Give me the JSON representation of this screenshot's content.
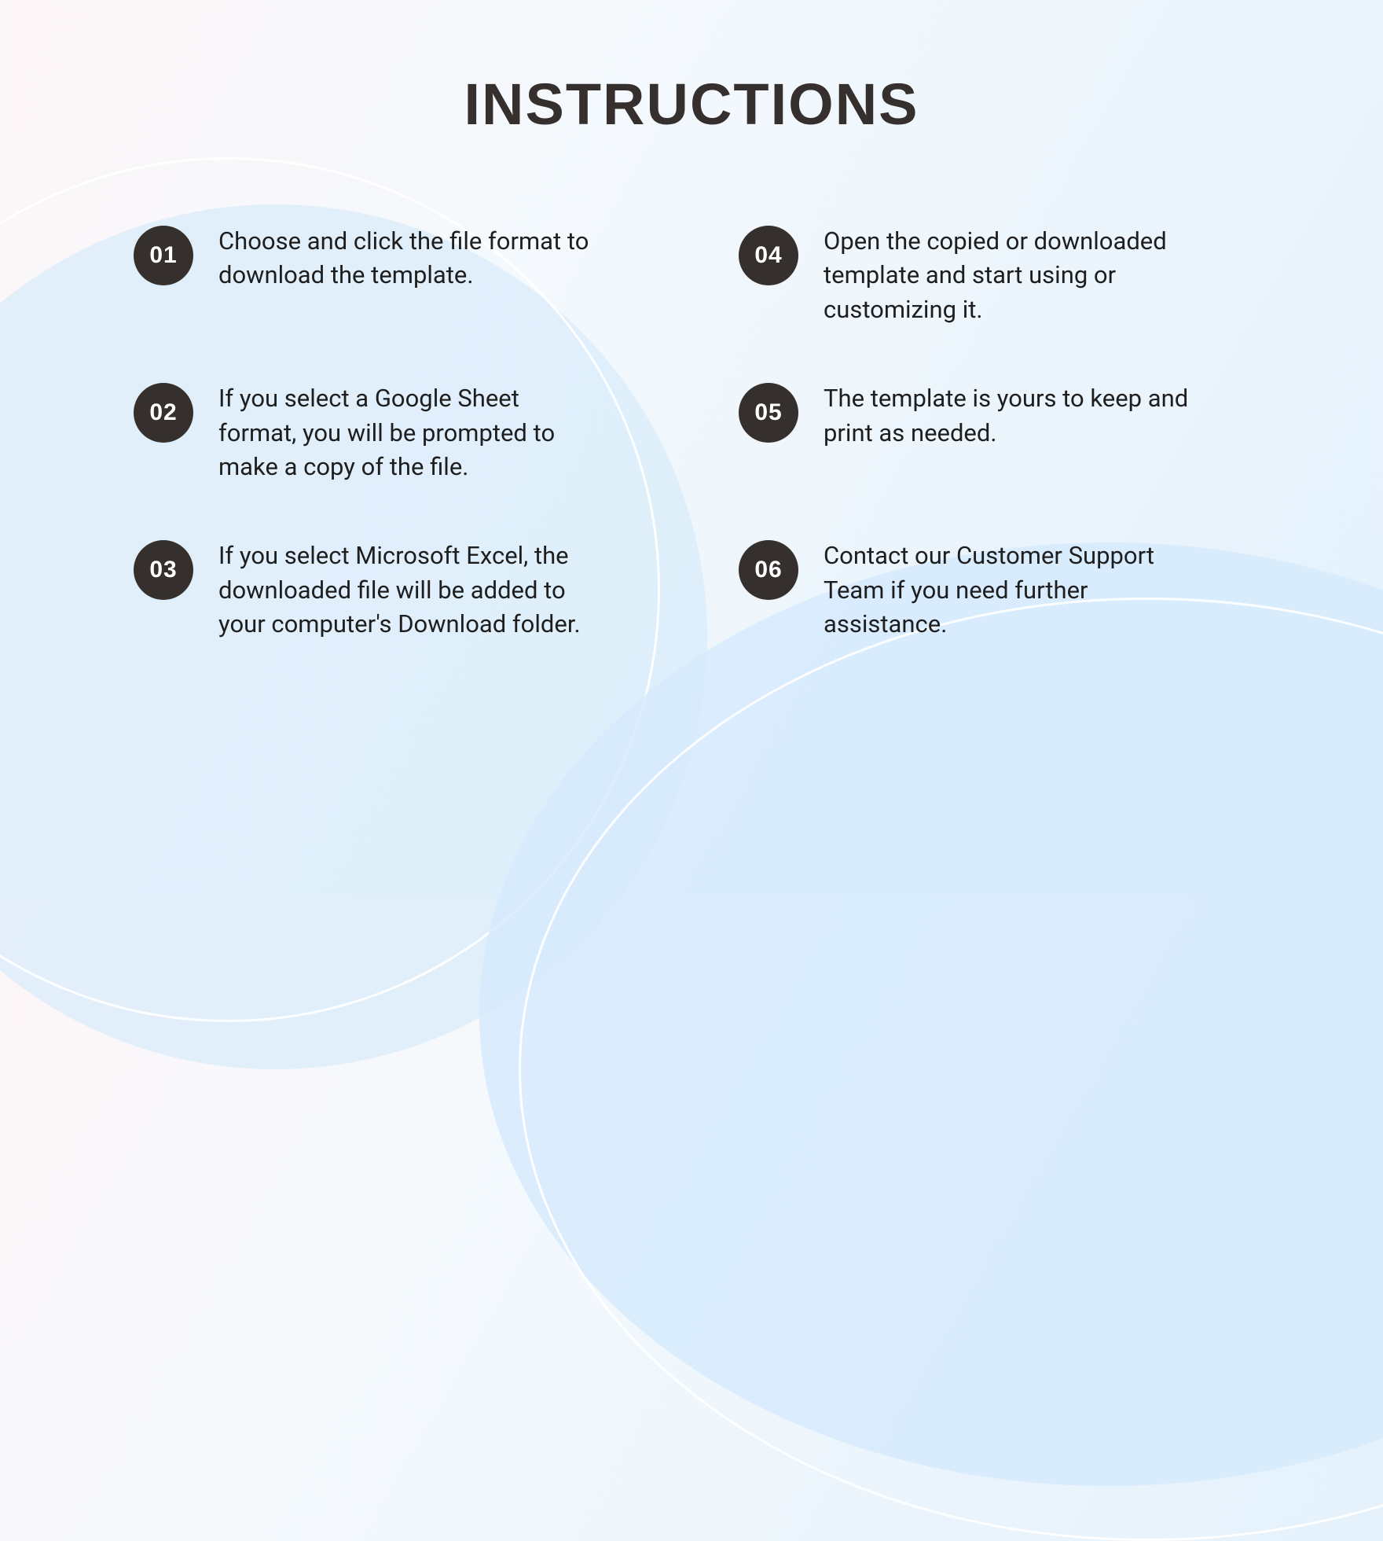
{
  "title": "INSTRUCTIONS",
  "steps": [
    {
      "num": "01",
      "text": "Choose and click the file format to download the template."
    },
    {
      "num": "04",
      "text": "Open the copied or downloaded template and start using or customizing it."
    },
    {
      "num": "02",
      "text": "If you select a Google Sheet format, you will be prompted to make a copy of the file."
    },
    {
      "num": "05",
      "text": "The template is yours to keep and print as needed."
    },
    {
      "num": "03",
      "text": "If you select Microsoft Excel, the downloaded file will be added to your computer's Download folder."
    },
    {
      "num": "06",
      "text": "Contact our Customer Support Team if you need further assistance."
    }
  ]
}
